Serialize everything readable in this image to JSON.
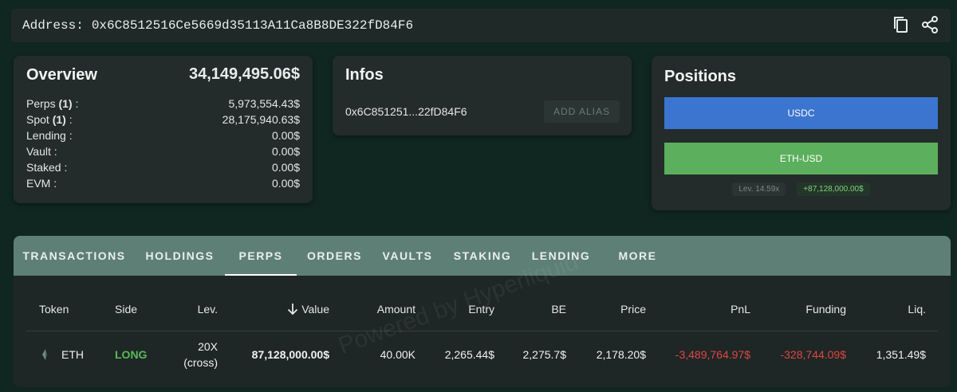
{
  "address_bar": {
    "label": "Address:",
    "value": "0x6C8512516Ce5669d35113A11Ca8B8DE322fD84F6",
    "icons": [
      "copy-icon",
      "share-icon"
    ]
  },
  "overview": {
    "title": "Overview",
    "total": "34,149,495.06$",
    "rows": [
      {
        "label": "Perps",
        "count": "(1)",
        "suffix": " :",
        "value": "5,973,554.43$"
      },
      {
        "label": "Spot",
        "count": "(1)",
        "suffix": " :",
        "value": "28,175,940.63$"
      },
      {
        "label": "Lending :",
        "count": "",
        "suffix": "",
        "value": "0.00$"
      },
      {
        "label": "Vault :",
        "count": "",
        "suffix": "",
        "value": "0.00$"
      },
      {
        "label": "Staked :",
        "count": "",
        "suffix": "",
        "value": "0.00$"
      },
      {
        "label": "EVM :",
        "count": "",
        "suffix": "",
        "value": "0.00$"
      }
    ]
  },
  "infos": {
    "title": "Infos",
    "short_address": "0x6C851251...22fD84F6",
    "add_alias_label": "ADD ALIAS"
  },
  "positions": {
    "title": "Positions",
    "bars": [
      {
        "label": "USDC",
        "color": "#3c75cf"
      },
      {
        "label": "ETH-USD",
        "color": "#5caf5c"
      }
    ],
    "leverage_tag": "Lev. 14.59x",
    "pnl_tag": "+87,128,000.00$"
  },
  "tabs": [
    {
      "label": "TRANSACTIONS",
      "active": false
    },
    {
      "label": "HOLDINGS",
      "active": false
    },
    {
      "label": "PERPS",
      "active": true
    },
    {
      "label": "ORDERS",
      "active": false
    },
    {
      "label": "VAULTS",
      "active": false
    },
    {
      "label": "STAKING",
      "active": false
    },
    {
      "label": "LENDING",
      "active": false
    },
    {
      "label": "MORE",
      "active": false
    }
  ],
  "table": {
    "columns": [
      "Token",
      "Side",
      "Lev.",
      "Value",
      "Amount",
      "Entry",
      "BE",
      "Price",
      "PnL",
      "Funding",
      "Liq."
    ],
    "sort_icon": "arrow-down-icon",
    "rows": [
      {
        "token": "ETH",
        "side": "LONG",
        "lev_line1": "20X",
        "lev_line2": "(cross)",
        "value": "87,128,000.00$",
        "amount": "40.00K",
        "entry": "2,265.44$",
        "be": "2,275.7$",
        "price": "2,178.20$",
        "pnl": "-3,489,764.97$",
        "funding": "-328,744.09$",
        "liq": "1,351.49$"
      }
    ]
  },
  "watermark": "Powered by Hyperliquid",
  "colors": {
    "background": "#0f2621",
    "card": "#232c2a",
    "tabs_bar": "#5e7f76",
    "long": "#5cb85c",
    "negative": "#e04545"
  }
}
